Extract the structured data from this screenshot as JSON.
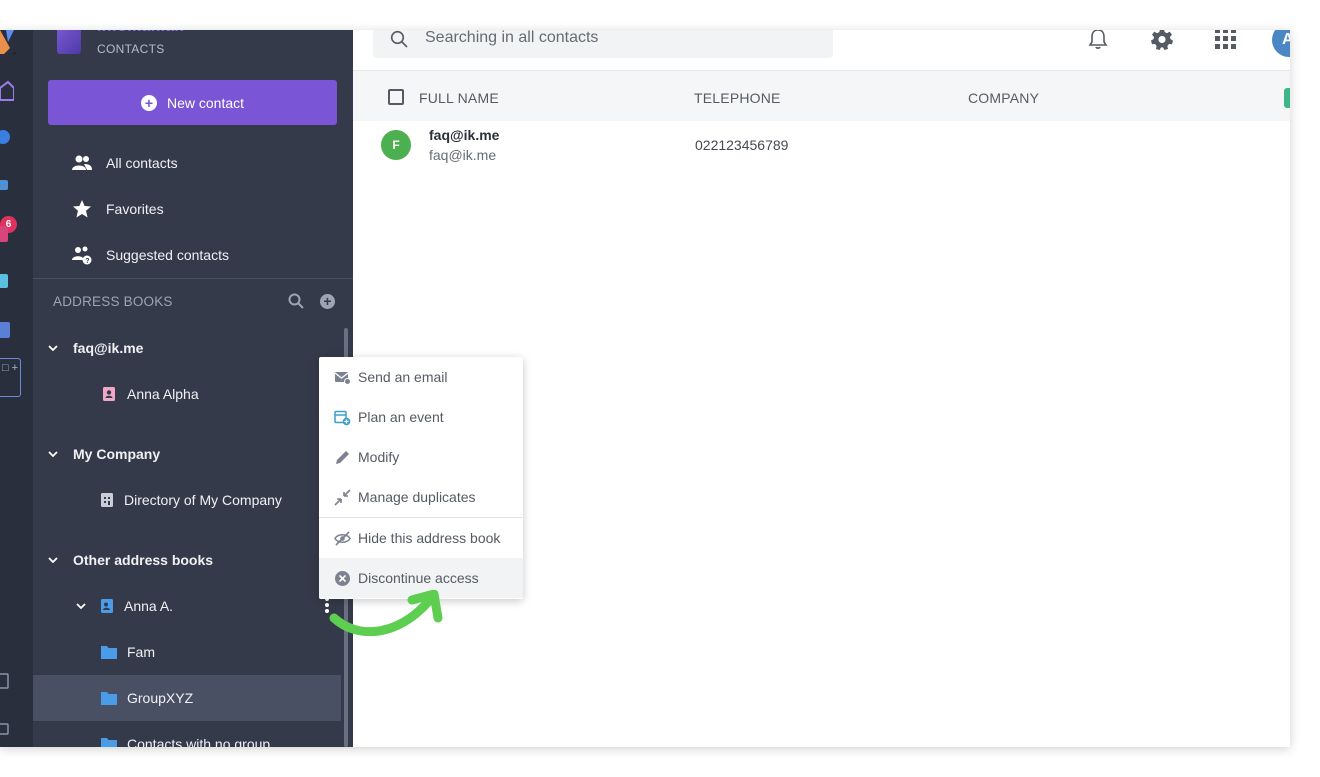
{
  "brand": {
    "name": "infomaniak",
    "subtitle": "CONTACTS"
  },
  "rail": {
    "notification_count": "6",
    "add_symbol": "□ +"
  },
  "sidebar": {
    "new_contact_label": "New contact",
    "nav": [
      {
        "label": "All contacts",
        "icon": "people-icon"
      },
      {
        "label": "Favorites",
        "icon": "star-icon"
      },
      {
        "label": "Suggested contacts",
        "icon": "suggested-people-icon"
      }
    ],
    "address_books_header": "ADDRESS BOOKS",
    "tree": [
      {
        "label": "faq@ik.me"
      },
      {
        "label": "Anna Alpha"
      },
      {
        "label": "My Company"
      },
      {
        "label": "Directory of My Company"
      },
      {
        "label": "Other address books"
      },
      {
        "label": "Anna A."
      },
      {
        "label": "Fam"
      },
      {
        "label": "GroupXYZ"
      },
      {
        "label": "Contacts with no group"
      }
    ]
  },
  "search": {
    "placeholder": "Searching in all contacts"
  },
  "header": {
    "avatar_initial": "A"
  },
  "table": {
    "columns": {
      "name": "FULL NAME",
      "telephone": "TELEPHONE",
      "company": "COMPANY"
    },
    "rows": [
      {
        "initial": "F",
        "name": "faq@ik.me",
        "email": "faq@ik.me",
        "telephone": "022123456789",
        "company": ""
      }
    ]
  },
  "context_menu": {
    "items": [
      {
        "label": "Send an email",
        "icon": "mail-icon"
      },
      {
        "label": "Plan an event",
        "icon": "calendar-add-icon"
      },
      {
        "label": "Modify",
        "icon": "pencil-icon"
      },
      {
        "label": "Manage duplicates",
        "icon": "merge-icon"
      },
      {
        "label": "Hide this address book",
        "icon": "eye-off-icon"
      },
      {
        "label": "Discontinue access",
        "icon": "close-circle-icon"
      }
    ]
  },
  "colors": {
    "primary": "#7a56d6",
    "sidebar_bg": "#353a4a",
    "rail_bg": "#2a2f3e",
    "annotation_arrow": "#5dce4f",
    "folder_blue": "#4a9be8"
  }
}
